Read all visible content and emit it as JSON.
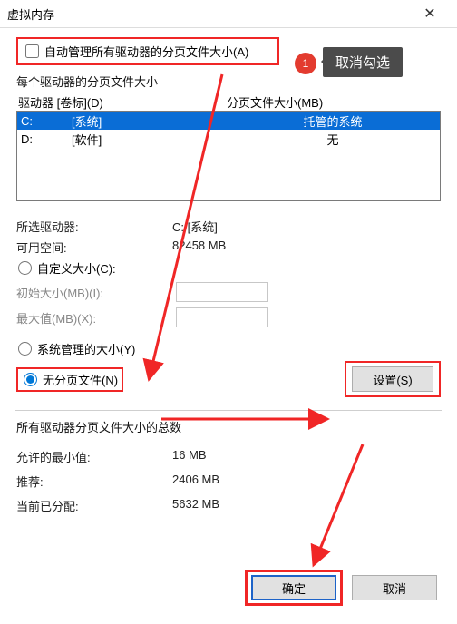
{
  "window": {
    "title": "虚拟内存",
    "close_icon": "✕"
  },
  "auto_manage": {
    "label": "自动管理所有驱动器的分页文件大小(A)"
  },
  "annotation": {
    "num": "1",
    "text": "取消勾选"
  },
  "per_drive_header": "每个驱动器的分页文件大小",
  "list": {
    "col_drive": "驱动器 [卷标](D)",
    "col_size": "分页文件大小(MB)",
    "rows": [
      {
        "letter": "C:",
        "label": "[系统]",
        "size": "托管的系统",
        "selected": true
      },
      {
        "letter": "D:",
        "label": "[软件]",
        "size": "无",
        "selected": false
      }
    ]
  },
  "selected_drive": {
    "key": "所选驱动器:",
    "val": "C:  [系统]"
  },
  "available": {
    "key": "可用空间:",
    "val": "82458 MB"
  },
  "opt_custom": "自定义大小(C):",
  "opt_system": "系统管理的大小(Y)",
  "opt_none": "无分页文件(N)",
  "initial_label": "初始大小(MB)(I):",
  "max_label": "最大值(MB)(X):",
  "set_button": "设置(S)",
  "totals_header": "所有驱动器分页文件大小的总数",
  "min": {
    "key": "允许的最小值:",
    "val": "16 MB"
  },
  "rec": {
    "key": "推荐:",
    "val": "2406 MB"
  },
  "alloc": {
    "key": "当前已分配:",
    "val": "5632 MB"
  },
  "ok_label": "确定",
  "cancel_label": "取消"
}
